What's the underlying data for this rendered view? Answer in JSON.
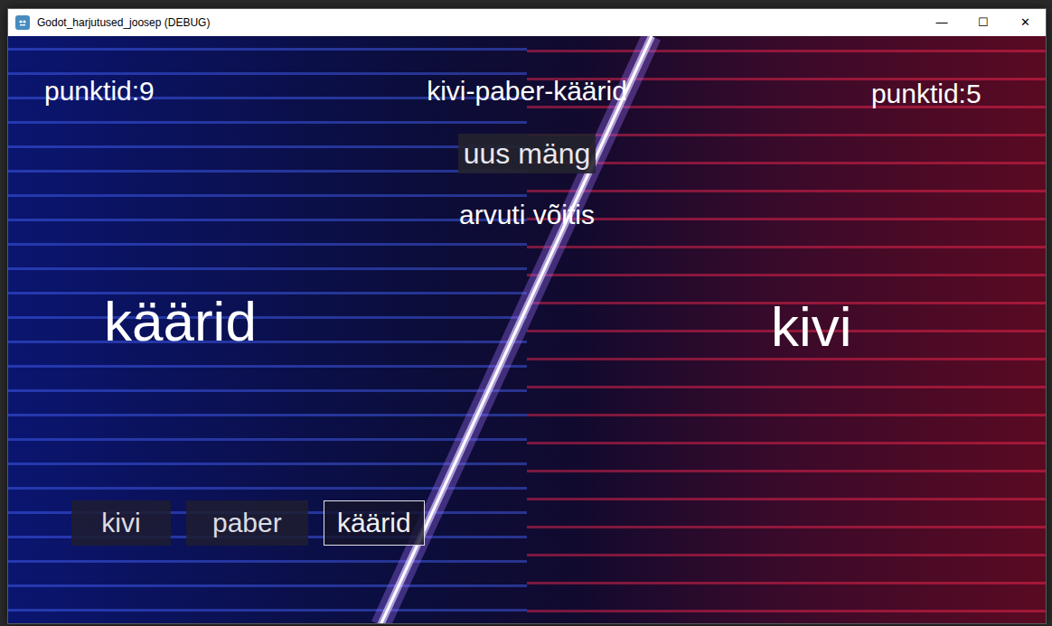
{
  "window": {
    "title": "Godot_harjutused_joosep (DEBUG)",
    "controls": [
      "—",
      "☐",
      "✕"
    ]
  },
  "game": {
    "player_score": "punktid:9",
    "title": "kivi-paber-käärid",
    "computer_score": "punktid:5",
    "new_game": "uus mäng",
    "result": "arvuti võitis",
    "player_choice": "käärid",
    "computer_choice": "kivi",
    "choices": [
      {
        "label": "kivi",
        "selected": false
      },
      {
        "label": "paber",
        "selected": false
      },
      {
        "label": "käärid",
        "selected": true
      }
    ]
  }
}
